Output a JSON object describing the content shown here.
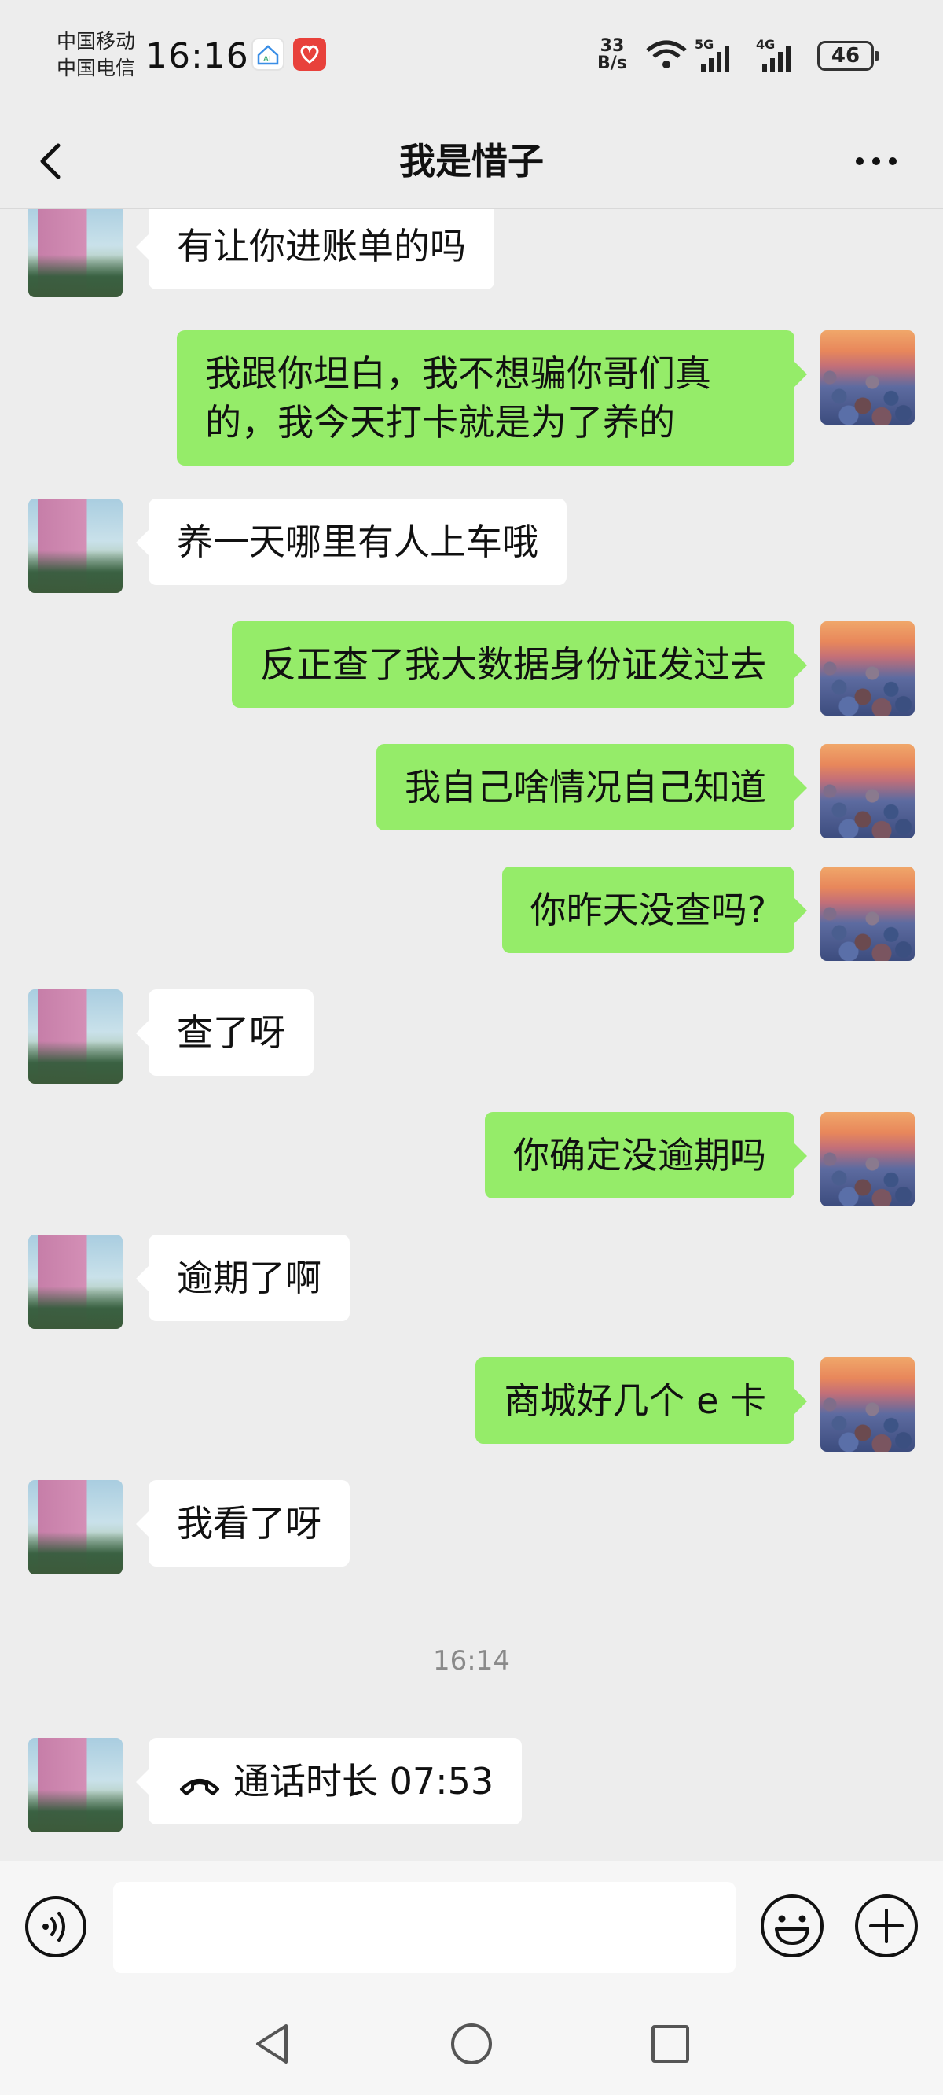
{
  "status_bar": {
    "carrier_1": "中国移动",
    "carrier_2": "中国电信",
    "time": "16:16",
    "net_speed_value": "33",
    "net_speed_unit": "B/s",
    "signal_1_label": "5G",
    "signal_2_label": "4G",
    "battery": "46"
  },
  "header": {
    "title": "我是惜子"
  },
  "messages": [
    {
      "side": "in",
      "text": "有让你进账单的吗"
    },
    {
      "side": "out",
      "text": "我跟你坦白，我不想骗你哥们真的，我今天打卡就是为了养的"
    },
    {
      "side": "in",
      "text": "养一天哪里有人上车哦"
    },
    {
      "side": "out",
      "text": "反正查了我大数据身份证发过去"
    },
    {
      "side": "out",
      "text": "我自己啥情况自己知道"
    },
    {
      "side": "out",
      "text": "你昨天没查吗?"
    },
    {
      "side": "in",
      "text": "查了呀"
    },
    {
      "side": "out",
      "text": "你确定没逾期吗"
    },
    {
      "side": "in",
      "text": "逾期了啊"
    },
    {
      "side": "out",
      "text": "商城好几个 e 卡"
    },
    {
      "side": "in",
      "text": "我看了呀"
    }
  ],
  "timestamp": "16:14",
  "call_record": {
    "text": "通话时长 07:53",
    "icon": "phone-hangup-icon"
  },
  "input_bar": {
    "value": "",
    "voice_icon": "voice-icon",
    "emoji_icon": "emoji-icon",
    "plus_icon": "plus-icon"
  },
  "colors": {
    "background": "#ededed",
    "outgoing_bubble": "#95ec69",
    "incoming_bubble": "#ffffff"
  }
}
